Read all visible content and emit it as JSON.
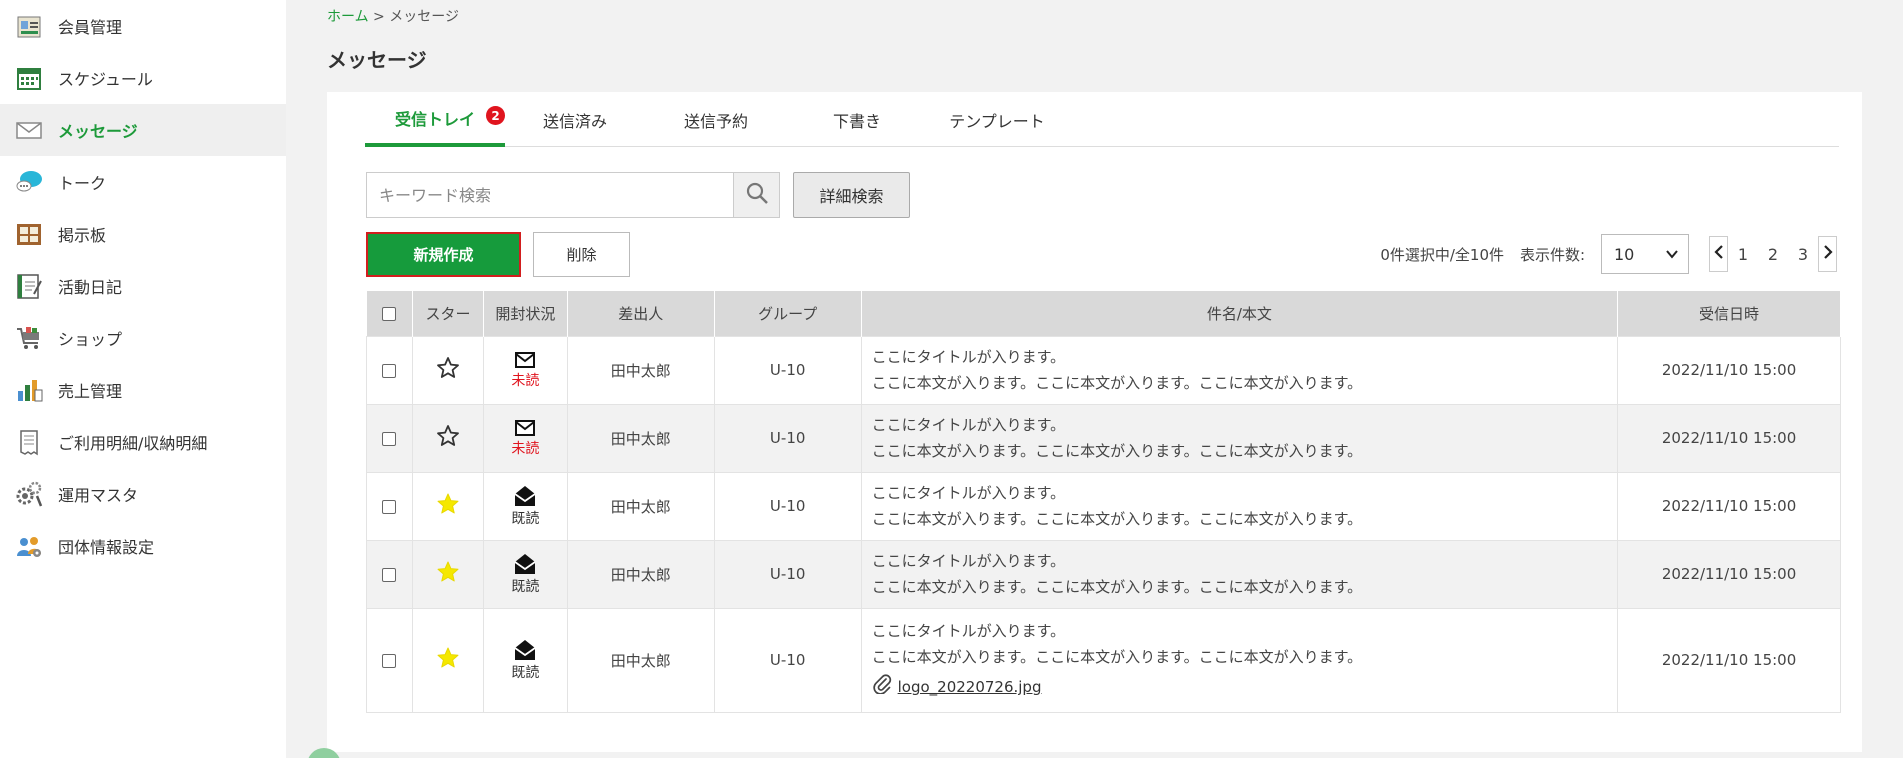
{
  "sidebar": {
    "items": [
      {
        "label": "会員管理",
        "icon": "member-card-icon"
      },
      {
        "label": "スケジュール",
        "icon": "calendar-icon"
      },
      {
        "label": "メッセージ",
        "icon": "envelope-icon",
        "active": true
      },
      {
        "label": "トーク",
        "icon": "chat-bubble-icon"
      },
      {
        "label": "掲示板",
        "icon": "bulletin-board-icon"
      },
      {
        "label": "活動日記",
        "icon": "diary-icon"
      },
      {
        "label": "ショップ",
        "icon": "cart-icon"
      },
      {
        "label": "売上管理",
        "icon": "sales-chart-icon"
      },
      {
        "label": "ご利用明細/収納明細",
        "icon": "receipt-icon"
      },
      {
        "label": "運用マスタ",
        "icon": "gears-icon"
      },
      {
        "label": "団体情報設定",
        "icon": "group-settings-icon"
      }
    ]
  },
  "breadcrumb": {
    "home": "ホーム",
    "separator": ">",
    "current": "メッセージ"
  },
  "page_title": "メッセージ",
  "tabs": [
    {
      "label": "受信トレイ",
      "active": true,
      "badge": "2"
    },
    {
      "label": "送信済み"
    },
    {
      "label": "送信予約"
    },
    {
      "label": "下書き"
    },
    {
      "label": "テンプレート"
    }
  ],
  "search": {
    "placeholder": "キーワード検索",
    "value": "",
    "advanced_label": "詳細検索"
  },
  "actions": {
    "new_label": "新規作成",
    "delete_label": "削除"
  },
  "selection_info": "0件選択中/全10件",
  "per_page": {
    "label": "表示件数:",
    "value": "10"
  },
  "pagination": {
    "pages": [
      "1",
      "2",
      "3"
    ]
  },
  "table": {
    "headers": [
      "スター",
      "開封状況",
      "差出人",
      "グループ",
      "件名/本文",
      "受信日時"
    ],
    "rows": [
      {
        "starred": false,
        "status": "未読",
        "sender": "田中太郎",
        "group": "U-10",
        "title": "ここにタイトルが入ります。",
        "body": "ここに本文が入ります。ここに本文が入ります。ここに本文が入ります。",
        "date": "2022/11/10 15:00"
      },
      {
        "starred": false,
        "status": "未読",
        "sender": "田中太郎",
        "group": "U-10",
        "title": "ここにタイトルが入ります。",
        "body": "ここに本文が入ります。ここに本文が入ります。ここに本文が入ります。",
        "date": "2022/11/10 15:00"
      },
      {
        "starred": true,
        "status": "既読",
        "sender": "田中太郎",
        "group": "U-10",
        "title": "ここにタイトルが入ります。",
        "body": "ここに本文が入ります。ここに本文が入ります。ここに本文が入ります。",
        "date": "2022/11/10 15:00"
      },
      {
        "starred": true,
        "status": "既読",
        "sender": "田中太郎",
        "group": "U-10",
        "title": "ここにタイトルが入ります。",
        "body": "ここに本文が入ります。ここに本文が入ります。ここに本文が入ります。",
        "date": "2022/11/10 15:00"
      },
      {
        "starred": true,
        "status": "既読",
        "sender": "田中太郎",
        "group": "U-10",
        "title": "ここにタイトルが入ります。",
        "body": "ここに本文が入ります。ここに本文が入ります。ここに本文が入ります。",
        "date": "2022/11/10 15:00",
        "attachment": "logo_20220726.jpg"
      }
    ]
  },
  "colors": {
    "accent": "#1d9a3a",
    "unread": "#e0141e",
    "star": "#f5e800",
    "badge": "#e0141e"
  }
}
